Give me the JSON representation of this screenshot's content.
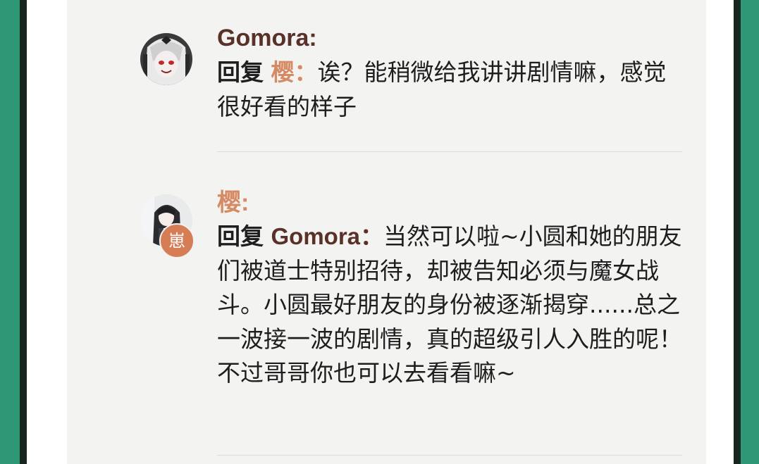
{
  "colors": {
    "gomora_name": "#5a3128",
    "sakura_name": "#d68a63",
    "badge_bg": "#d77d56",
    "panel_bg": "#f3f3f1",
    "frame_green": "#2f9676"
  },
  "comments": [
    {
      "username": "Gomora:",
      "reply_word": "回复",
      "reply_target": "樱：",
      "text": "诶？能稍微给我讲讲剧情嘛，感觉很好看的样子"
    },
    {
      "username": "樱:",
      "badge": "崽",
      "reply_word": "回复",
      "reply_target": "Gomora：",
      "text": "当然可以啦~小圆和她的朋友们被道士特别招待，却被告知必须与魔女战斗。小圆最好朋友的身份被逐渐揭穿......总之一波接一波的剧情，真的超级引人入胜的呢！不过哥哥你也可以去看看嘛~"
    }
  ]
}
